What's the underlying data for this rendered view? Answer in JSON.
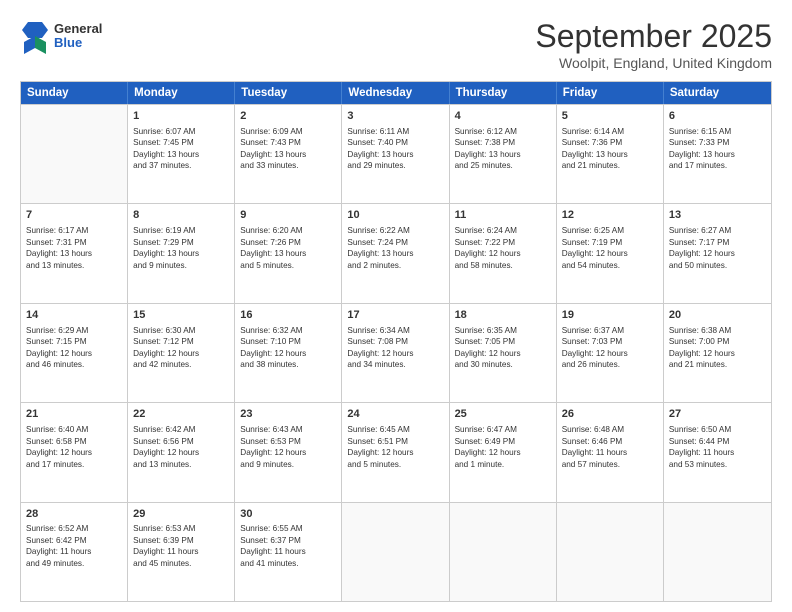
{
  "header": {
    "logo": {
      "line1": "General",
      "line2": "Blue"
    },
    "title": "September 2025",
    "location": "Woolpit, England, United Kingdom"
  },
  "calendar": {
    "days": [
      "Sunday",
      "Monday",
      "Tuesday",
      "Wednesday",
      "Thursday",
      "Friday",
      "Saturday"
    ],
    "rows": [
      [
        {
          "day": "",
          "sunrise": "",
          "sunset": "",
          "daylight": "",
          "empty": true
        },
        {
          "day": "1",
          "sunrise": "Sunrise: 6:07 AM",
          "sunset": "Sunset: 7:45 PM",
          "daylight": "Daylight: 13 hours and 37 minutes."
        },
        {
          "day": "2",
          "sunrise": "Sunrise: 6:09 AM",
          "sunset": "Sunset: 7:43 PM",
          "daylight": "Daylight: 13 hours and 33 minutes."
        },
        {
          "day": "3",
          "sunrise": "Sunrise: 6:11 AM",
          "sunset": "Sunset: 7:40 PM",
          "daylight": "Daylight: 13 hours and 29 minutes."
        },
        {
          "day": "4",
          "sunrise": "Sunrise: 6:12 AM",
          "sunset": "Sunset: 7:38 PM",
          "daylight": "Daylight: 13 hours and 25 minutes."
        },
        {
          "day": "5",
          "sunrise": "Sunrise: 6:14 AM",
          "sunset": "Sunset: 7:36 PM",
          "daylight": "Daylight: 13 hours and 21 minutes."
        },
        {
          "day": "6",
          "sunrise": "Sunrise: 6:15 AM",
          "sunset": "Sunset: 7:33 PM",
          "daylight": "Daylight: 13 hours and 17 minutes."
        }
      ],
      [
        {
          "day": "7",
          "sunrise": "Sunrise: 6:17 AM",
          "sunset": "Sunset: 7:31 PM",
          "daylight": "Daylight: 13 hours and 13 minutes."
        },
        {
          "day": "8",
          "sunrise": "Sunrise: 6:19 AM",
          "sunset": "Sunset: 7:29 PM",
          "daylight": "Daylight: 13 hours and 9 minutes."
        },
        {
          "day": "9",
          "sunrise": "Sunrise: 6:20 AM",
          "sunset": "Sunset: 7:26 PM",
          "daylight": "Daylight: 13 hours and 5 minutes."
        },
        {
          "day": "10",
          "sunrise": "Sunrise: 6:22 AM",
          "sunset": "Sunset: 7:24 PM",
          "daylight": "Daylight: 13 hours and 2 minutes."
        },
        {
          "day": "11",
          "sunrise": "Sunrise: 6:24 AM",
          "sunset": "Sunset: 7:22 PM",
          "daylight": "Daylight: 12 hours and 58 minutes."
        },
        {
          "day": "12",
          "sunrise": "Sunrise: 6:25 AM",
          "sunset": "Sunset: 7:19 PM",
          "daylight": "Daylight: 12 hours and 54 minutes."
        },
        {
          "day": "13",
          "sunrise": "Sunrise: 6:27 AM",
          "sunset": "Sunset: 7:17 PM",
          "daylight": "Daylight: 12 hours and 50 minutes."
        }
      ],
      [
        {
          "day": "14",
          "sunrise": "Sunrise: 6:29 AM",
          "sunset": "Sunset: 7:15 PM",
          "daylight": "Daylight: 12 hours and 46 minutes."
        },
        {
          "day": "15",
          "sunrise": "Sunrise: 6:30 AM",
          "sunset": "Sunset: 7:12 PM",
          "daylight": "Daylight: 12 hours and 42 minutes."
        },
        {
          "day": "16",
          "sunrise": "Sunrise: 6:32 AM",
          "sunset": "Sunset: 7:10 PM",
          "daylight": "Daylight: 12 hours and 38 minutes."
        },
        {
          "day": "17",
          "sunrise": "Sunrise: 6:34 AM",
          "sunset": "Sunset: 7:08 PM",
          "daylight": "Daylight: 12 hours and 34 minutes."
        },
        {
          "day": "18",
          "sunrise": "Sunrise: 6:35 AM",
          "sunset": "Sunset: 7:05 PM",
          "daylight": "Daylight: 12 hours and 30 minutes."
        },
        {
          "day": "19",
          "sunrise": "Sunrise: 6:37 AM",
          "sunset": "Sunset: 7:03 PM",
          "daylight": "Daylight: 12 hours and 26 minutes."
        },
        {
          "day": "20",
          "sunrise": "Sunrise: 6:38 AM",
          "sunset": "Sunset: 7:00 PM",
          "daylight": "Daylight: 12 hours and 21 minutes."
        }
      ],
      [
        {
          "day": "21",
          "sunrise": "Sunrise: 6:40 AM",
          "sunset": "Sunset: 6:58 PM",
          "daylight": "Daylight: 12 hours and 17 minutes."
        },
        {
          "day": "22",
          "sunrise": "Sunrise: 6:42 AM",
          "sunset": "Sunset: 6:56 PM",
          "daylight": "Daylight: 12 hours and 13 minutes."
        },
        {
          "day": "23",
          "sunrise": "Sunrise: 6:43 AM",
          "sunset": "Sunset: 6:53 PM",
          "daylight": "Daylight: 12 hours and 9 minutes."
        },
        {
          "day": "24",
          "sunrise": "Sunrise: 6:45 AM",
          "sunset": "Sunset: 6:51 PM",
          "daylight": "Daylight: 12 hours and 5 minutes."
        },
        {
          "day": "25",
          "sunrise": "Sunrise: 6:47 AM",
          "sunset": "Sunset: 6:49 PM",
          "daylight": "Daylight: 12 hours and 1 minute."
        },
        {
          "day": "26",
          "sunrise": "Sunrise: 6:48 AM",
          "sunset": "Sunset: 6:46 PM",
          "daylight": "Daylight: 11 hours and 57 minutes."
        },
        {
          "day": "27",
          "sunrise": "Sunrise: 6:50 AM",
          "sunset": "Sunset: 6:44 PM",
          "daylight": "Daylight: 11 hours and 53 minutes."
        }
      ],
      [
        {
          "day": "28",
          "sunrise": "Sunrise: 6:52 AM",
          "sunset": "Sunset: 6:42 PM",
          "daylight": "Daylight: 11 hours and 49 minutes."
        },
        {
          "day": "29",
          "sunrise": "Sunrise: 6:53 AM",
          "sunset": "Sunset: 6:39 PM",
          "daylight": "Daylight: 11 hours and 45 minutes."
        },
        {
          "day": "30",
          "sunrise": "Sunrise: 6:55 AM",
          "sunset": "Sunset: 6:37 PM",
          "daylight": "Daylight: 11 hours and 41 minutes."
        },
        {
          "day": "",
          "sunrise": "",
          "sunset": "",
          "daylight": "",
          "empty": true
        },
        {
          "day": "",
          "sunrise": "",
          "sunset": "",
          "daylight": "",
          "empty": true
        },
        {
          "day": "",
          "sunrise": "",
          "sunset": "",
          "daylight": "",
          "empty": true
        },
        {
          "day": "",
          "sunrise": "",
          "sunset": "",
          "daylight": "",
          "empty": true
        }
      ]
    ]
  }
}
